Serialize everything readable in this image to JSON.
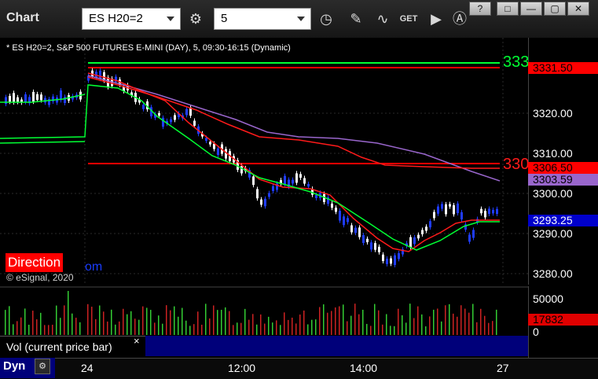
{
  "toolbar": {
    "app_title": "Chart",
    "symbol": "ES H20=2",
    "interval": "5",
    "icons": [
      "settings-icon",
      "clock-icon",
      "pencil-icon",
      "study-icon",
      "get-icon",
      "play-icon",
      "font-a-icon"
    ]
  },
  "window": {
    "help": "?",
    "restore": "□",
    "minimize": "—",
    "maximize": "▢",
    "close": "✕"
  },
  "chart": {
    "header": "* ES H20=2, S&P 500 FUTURES E-MINI (DAY), 5, 09:30-16:15 (Dynamic)",
    "yaxis_ticks": [
      "3320.00",
      "3310.00",
      "3300.00",
      "3290.00",
      "3280.00"
    ],
    "price_tags": [
      {
        "label": "3331.50",
        "bg": "#ff0000",
        "fg": "#000000"
      },
      {
        "label": "3306.50",
        "bg": "#ff0000",
        "fg": "#000000"
      },
      {
        "label": "3303.59",
        "bg": "#9966cc",
        "fg": "#000000"
      },
      {
        "label": "3293.25",
        "bg": "#0000cc",
        "fg": "#ffffff"
      }
    ],
    "line_labels": [
      "333",
      "330"
    ],
    "direction": "Direction",
    "com": "om",
    "copyright": "© eSignal, 2020",
    "xaxis_labels": [
      "24",
      "12:00",
      "14:00",
      "27"
    ],
    "volume": {
      "legend": "Vol (current price bar)",
      "close": "×",
      "ticks": [
        "50000",
        "0"
      ],
      "last": "17832"
    },
    "dyn": "Dyn",
    "colors": {
      "up": "#ffffff",
      "down": "#1f3cff",
      "ma_fast": "#ff1a1a",
      "ma_green": "#00ff33",
      "ma_purple": "#9966cc"
    }
  },
  "chart_data": {
    "type": "line",
    "x": [
      "24",
      "12:00",
      "14:00",
      "27"
    ],
    "series": [],
    "ylim": [
      3277,
      3338
    ]
  }
}
